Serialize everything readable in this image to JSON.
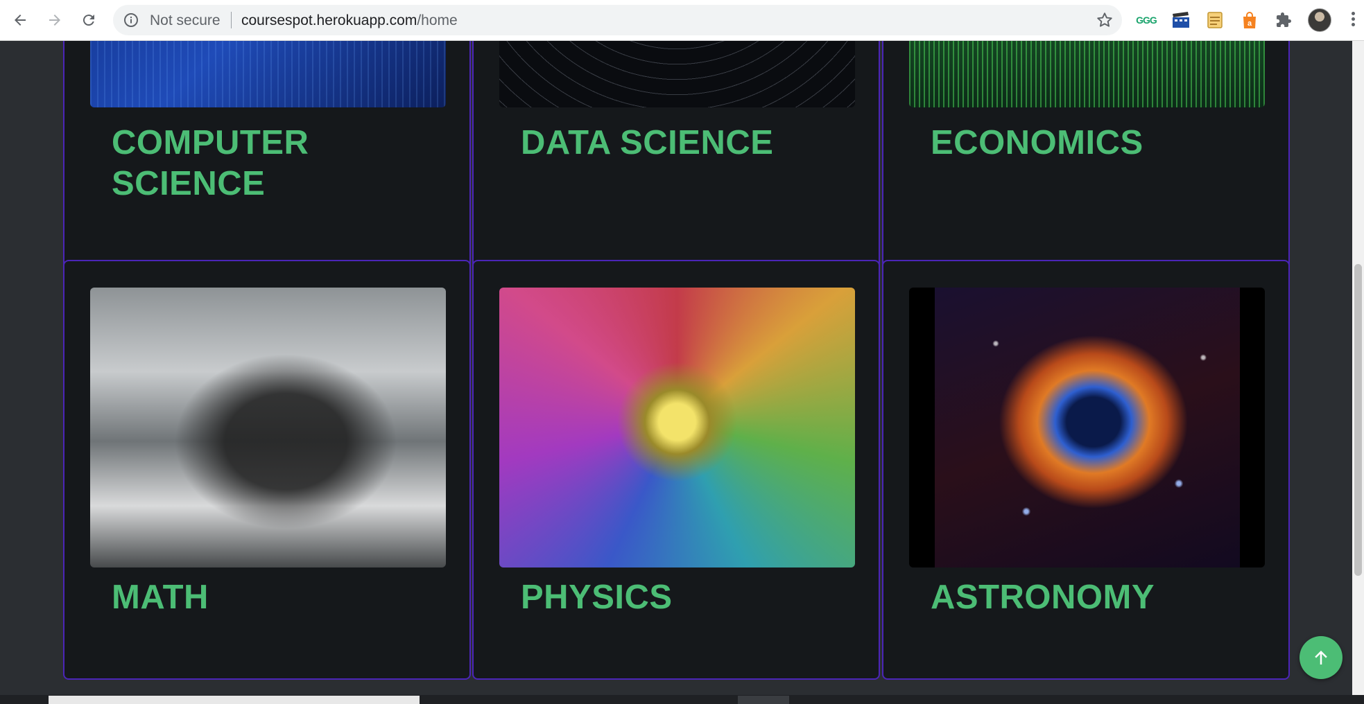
{
  "browser": {
    "security_label": "Not secure",
    "url_host": "coursespot.herokuapp.com",
    "url_path": "/home",
    "extensions": [
      "ggg-icon",
      "film-icon",
      "note-icon",
      "store-icon",
      "puzzle-icon"
    ],
    "ext_ggg_text": "GGG"
  },
  "courses": [
    {
      "title": "COMPUTER SCIENCE"
    },
    {
      "title": "DATA SCIENCE"
    },
    {
      "title": "ECONOMICS"
    },
    {
      "title": "MATH"
    },
    {
      "title": "PHYSICS"
    },
    {
      "title": "ASTRONOMY"
    }
  ],
  "colors": {
    "accent": "#4cbd75",
    "card_border": "#4b25b8",
    "card_bg": "#15181b",
    "page_bg": "#2b2e32"
  }
}
